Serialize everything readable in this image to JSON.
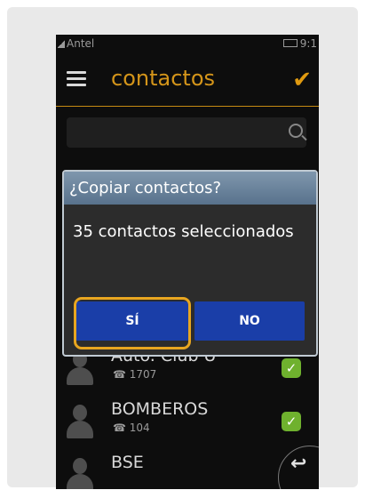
{
  "status_bar": {
    "carrier": "Antel",
    "time": "9:1"
  },
  "app_bar": {
    "title": "contactos"
  },
  "contacts": [
    {
      "name": "Auto. Club U",
      "phone": "1707",
      "checked": true
    },
    {
      "name": "BOMBEROS",
      "phone": "104",
      "checked": true
    },
    {
      "name": "BSE",
      "phone": "",
      "checked": false
    }
  ],
  "dialog": {
    "title": "¿Copiar contactos?",
    "message": "35 contactos seleccionados",
    "yes_label": "SÍ",
    "no_label": "NO"
  },
  "colors": {
    "accent": "#d4951a",
    "dialog_button": "#1a3ea8",
    "highlight": "#e8a620",
    "checkbox": "#6fb12e"
  },
  "icons": [
    "signal-icon",
    "battery-icon",
    "menu-icon",
    "check-icon",
    "search-icon",
    "avatar-icon",
    "back-icon"
  ]
}
